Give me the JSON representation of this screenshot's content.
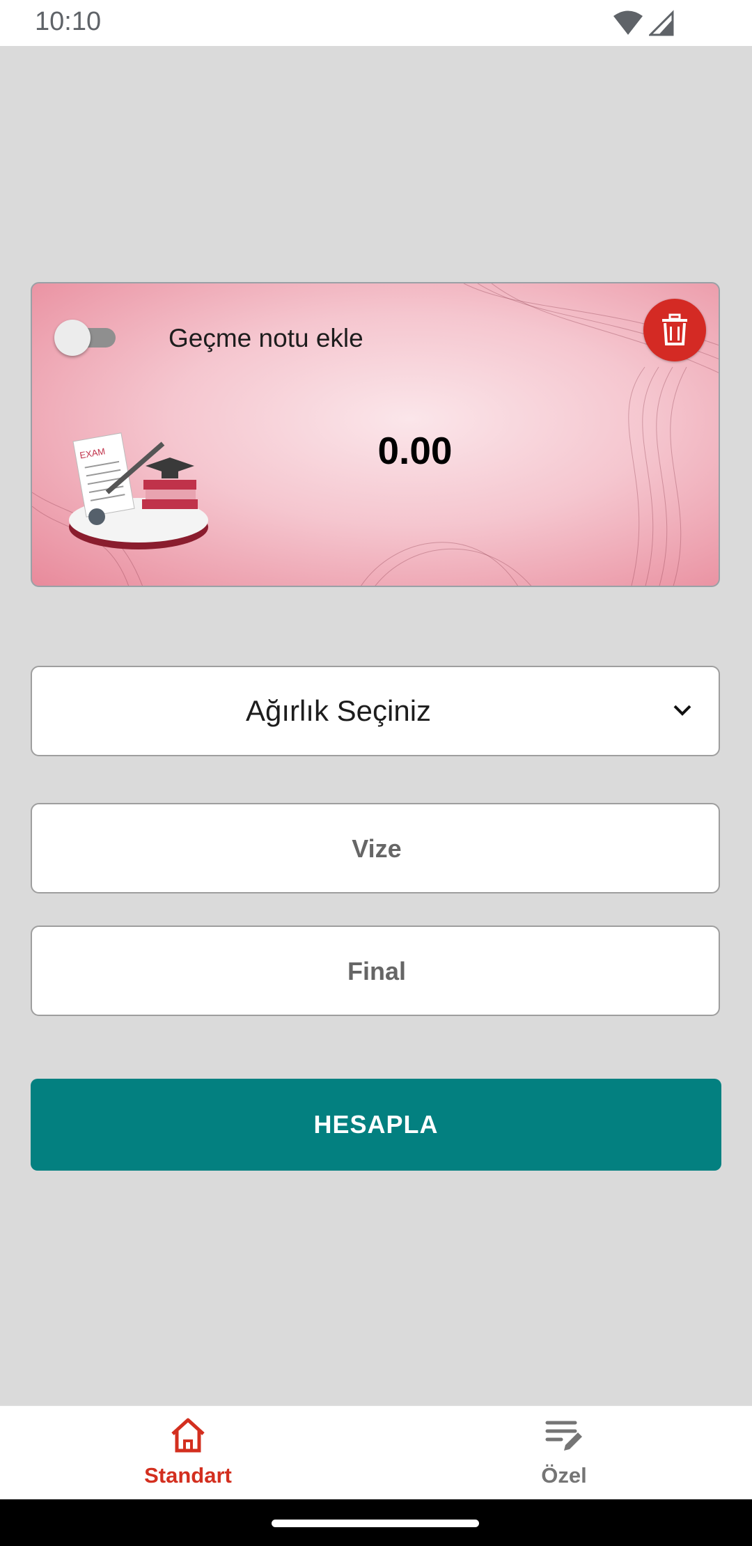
{
  "status_bar": {
    "time": "10:10"
  },
  "card": {
    "toggle_label": "Geçme notu ekle",
    "toggle_on": false,
    "result": "0.00",
    "illustration_text": "EXAM",
    "gradient_colors": [
      "#fbe6ea",
      "#e88a9b"
    ],
    "delete_color": "#d42a24"
  },
  "form": {
    "weight_select": "Ağırlık Seçiniz",
    "midterm_placeholder": "Vize",
    "final_placeholder": "Final",
    "calculate_label": "HESAPLA",
    "button_color": "#038080"
  },
  "bottom_nav": {
    "items": [
      {
        "label": "Standart",
        "icon": "home-icon",
        "active": true
      },
      {
        "label": "Özel",
        "icon": "edit-list-icon",
        "active": false
      }
    ],
    "active_color": "#d32f1f",
    "inactive_color": "#757575"
  }
}
